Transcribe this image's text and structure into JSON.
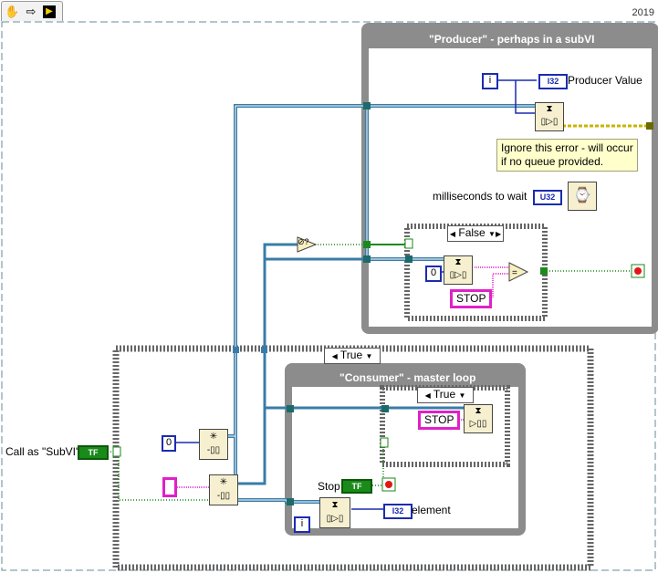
{
  "toolbar": {
    "tools": [
      "hand-icon",
      "arrow-icon",
      "run-icon"
    ],
    "version": "2019"
  },
  "producer": {
    "title": "\"Producer\" - perhaps in a subVI",
    "value_label": "Producer Value",
    "value_type": "I32",
    "iteration_terminal": "i",
    "note": [
      "Ignore this error - will occur",
      "if no queue provided."
    ],
    "wait_label": "milliseconds to wait",
    "wait_type": "U32",
    "case_selector": "False",
    "zero_constant": "0",
    "stop_constant": "STOP"
  },
  "outer_case": {
    "selector": "True",
    "call_as_subvi_label": "Call as \"SubVI\"",
    "call_as_subvi_type": "TF",
    "zero_constant": "0"
  },
  "consumer": {
    "title": "\"Consumer\" - master loop",
    "case_selector": "True",
    "stop_constant": "STOP",
    "stop_label": "Stop",
    "stop_type": "TF",
    "element_label": "element",
    "element_type": "I32",
    "iteration_terminal": "i"
  },
  "colors": {
    "loop_frame": "#8c8c8c",
    "queue_wire": "#3a7ca8",
    "string_wire": "#e020c8",
    "bool_wire": "#1a8a1a",
    "num_wire": "#1a2cb0",
    "error_wire": "#c8b400"
  }
}
